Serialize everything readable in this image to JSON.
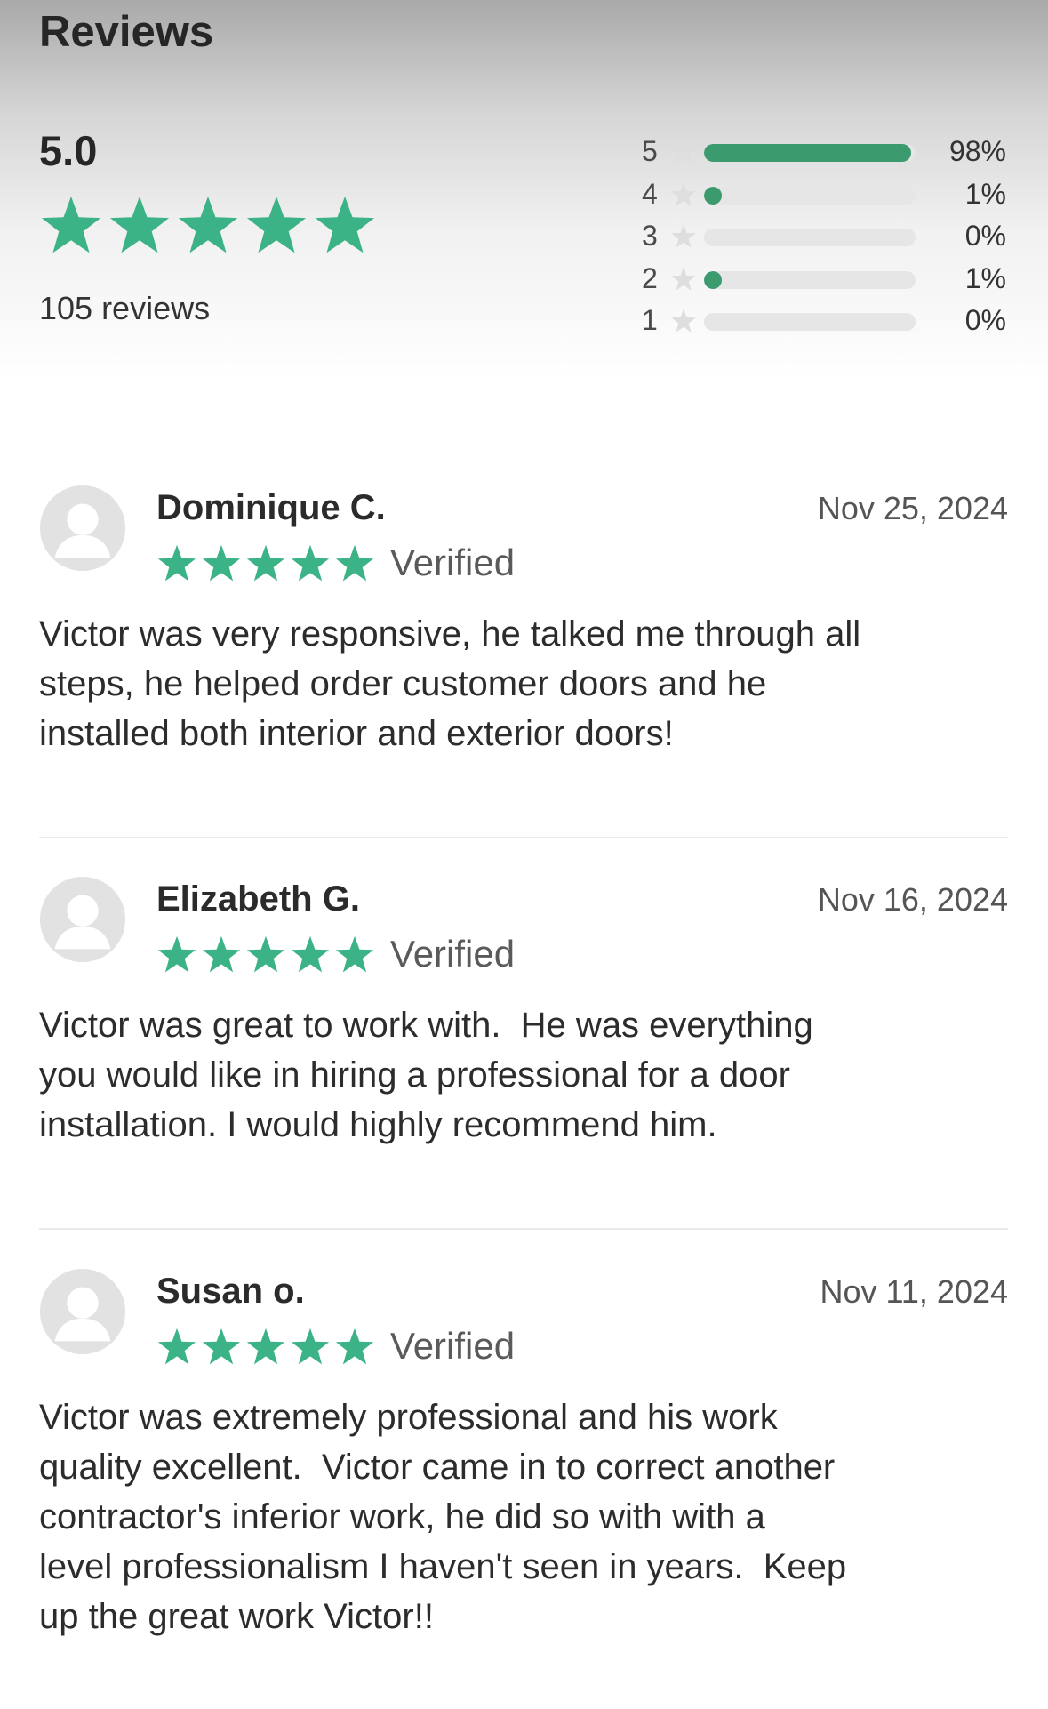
{
  "summary": {
    "title": "Reviews",
    "average": "5.0",
    "average_stars": 5,
    "review_count": "105 reviews",
    "star_color": "#3cb386",
    "bar_color": "#3c9a6f",
    "distribution": [
      {
        "stars": "5",
        "percent_label": "98%",
        "fraction": 0.98
      },
      {
        "stars": "4",
        "percent_label": "1%",
        "fraction": 0.01
      },
      {
        "stars": "3",
        "percent_label": "0%",
        "fraction": 0.0
      },
      {
        "stars": "2",
        "percent_label": "1%",
        "fraction": 0.01
      },
      {
        "stars": "1",
        "percent_label": "0%",
        "fraction": 0.0
      }
    ]
  },
  "reviews": [
    {
      "name": "Dominique C.",
      "date": "Nov 25, 2024",
      "rating": 5,
      "badge": "Verified",
      "body": "Victor was very responsive, he talked me through all\nsteps, he helped order customer doors and he\ninstalled both interior and exterior doors!"
    },
    {
      "name": "Elizabeth G.",
      "date": "Nov 16, 2024",
      "rating": 5,
      "badge": "Verified",
      "body": "Victor was great to work with.  He was everything\nyou would like in hiring a professional for a door\ninstallation. I would highly recommend him."
    },
    {
      "name": "Susan o.",
      "date": "Nov 11, 2024",
      "rating": 5,
      "badge": "Verified",
      "body": "Victor was extremely professional and his work\nquality excellent.  Victor came in to correct another\ncontractor's inferior work, he did so with with a\nlevel professionalism I haven't seen in years.  Keep\nup the great work Victor!!"
    }
  ]
}
